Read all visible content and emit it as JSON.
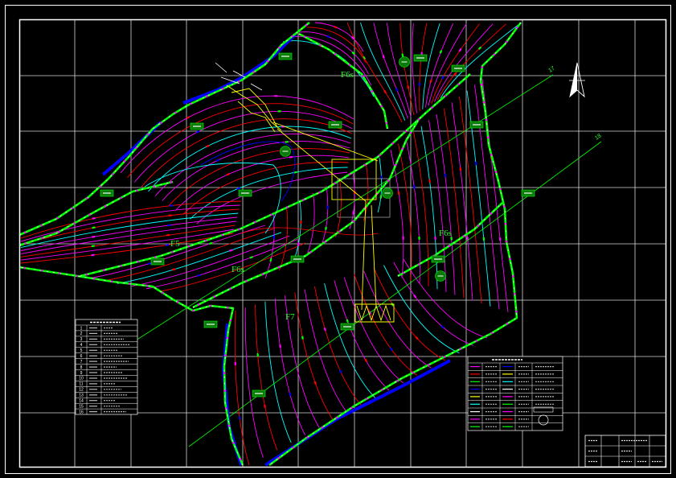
{
  "drawing": {
    "region_labels": {
      "upper": "F6s",
      "left": "F5",
      "middle": "F6s",
      "lower": "F7",
      "right": "F6s"
    },
    "section_lines": {
      "first": "17",
      "second": "18"
    }
  },
  "legend": {
    "row_numbers": [
      "1",
      "2",
      "3",
      "4",
      "5",
      "6",
      "7",
      "8",
      "9",
      "10",
      "11",
      "12",
      "13",
      "14",
      "15",
      "16"
    ]
  },
  "symbols": {
    "north_arrow": "north-arrow-icon"
  },
  "colors": {
    "background": "#000000",
    "frame": "#ffffff",
    "grid": "#d9d9d9",
    "contour_magenta": "#ff00ff",
    "contour_red": "#ff0000",
    "contour_cyan": "#00ffff",
    "boundary_green": "#00ff00",
    "edge_blue": "#0000ff",
    "structure_yellow": "#ffff00",
    "label_green": "#2bff2b",
    "tag_fill": "#0b7a0b"
  }
}
